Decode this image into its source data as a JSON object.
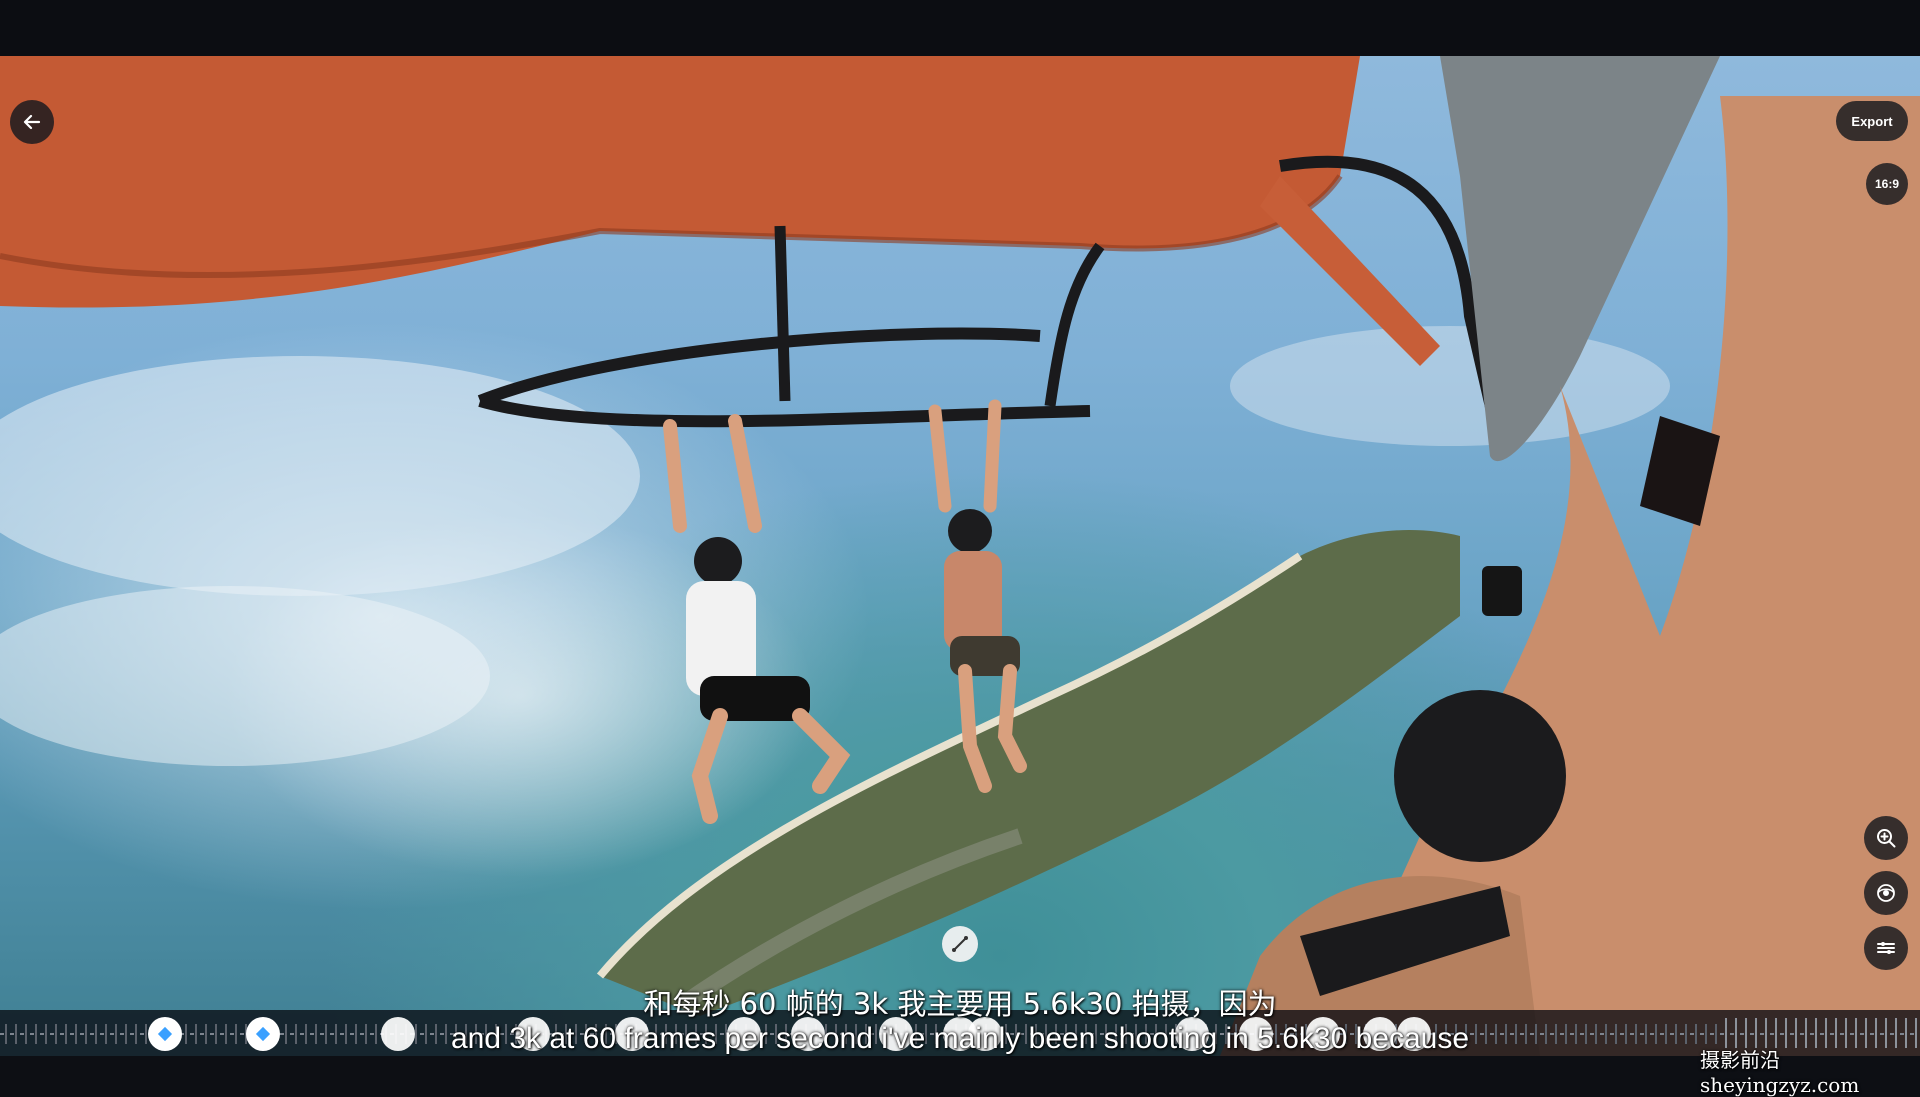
{
  "controls": {
    "back_icon": "arrow-left-icon",
    "export_label": "Export",
    "aspect_ratio": "16:9",
    "zoom_icon": "zoom-in-icon",
    "view_icon": "view-mode-icon",
    "adjust_icon": "adjust-icon",
    "edit_point_icon": "curve-edit-icon"
  },
  "subtitles": {
    "chinese": "和每秒 60 帧的 3k 我主要用 5.6k30 拍摄，因为",
    "english": "and 3k at 60 frames per second i've mainly been shooting in 5.6k30 because"
  },
  "watermark": "摄影前沿 sheyingzyz.com",
  "timeline": {
    "accent_color": "#3aa0ff",
    "keyframe_color": "#ffffff"
  }
}
